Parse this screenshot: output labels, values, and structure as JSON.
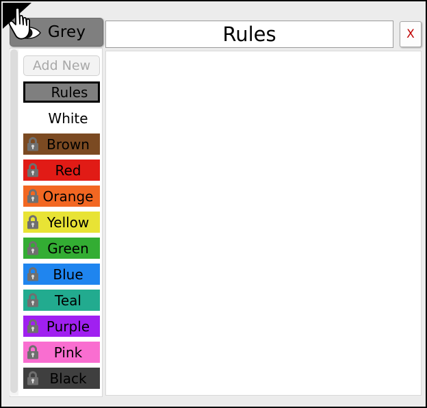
{
  "window": {
    "background": "#ececec",
    "border_color": "#000000"
  },
  "topbar": {
    "visibility_button": {
      "label": "Grey",
      "icon": "eye-icon",
      "background": "#7f7f7f"
    },
    "title_field": {
      "value": "Rules",
      "placeholder": "Rules"
    },
    "close_button": {
      "label": "X",
      "color": "#c00000"
    },
    "cursor": "hand-pointer-cursor"
  },
  "sidebar": {
    "add_new_button": {
      "label": "Add New",
      "enabled": false
    },
    "scrollbar": {
      "track_color": "#f4f4f4",
      "thumb_color": "#dcdcdc"
    },
    "items": [
      {
        "label": "Rules",
        "bg": "#7f7f7f",
        "text": "#000000",
        "locked": false,
        "selected": true
      },
      {
        "label": "White",
        "bg": "#ffffff",
        "text": "#000000",
        "locked": false,
        "selected": false
      },
      {
        "label": "Brown",
        "bg": "#7b4a22",
        "text": "#000000",
        "locked": true,
        "selected": false
      },
      {
        "label": "Red",
        "bg": "#e11b16",
        "text": "#000000",
        "locked": true,
        "selected": false
      },
      {
        "label": "Orange",
        "bg": "#f26722",
        "text": "#000000",
        "locked": true,
        "selected": false
      },
      {
        "label": "Yellow",
        "bg": "#e8e335",
        "text": "#000000",
        "locked": true,
        "selected": false
      },
      {
        "label": "Green",
        "bg": "#33ad33",
        "text": "#000000",
        "locked": true,
        "selected": false
      },
      {
        "label": "Blue",
        "bg": "#1f85ef",
        "text": "#000000",
        "locked": true,
        "selected": false
      },
      {
        "label": "Teal",
        "bg": "#22ab8f",
        "text": "#000000",
        "locked": true,
        "selected": false
      },
      {
        "label": "Purple",
        "bg": "#a020f0",
        "text": "#000000",
        "locked": true,
        "selected": false
      },
      {
        "label": "Pink",
        "bg": "#f96ed0",
        "text": "#000000",
        "locked": true,
        "selected": false
      },
      {
        "label": "Black",
        "bg": "#3f3f3f",
        "text": "#000000",
        "locked": true,
        "selected": false
      }
    ]
  },
  "content_panel": {
    "text": ""
  }
}
